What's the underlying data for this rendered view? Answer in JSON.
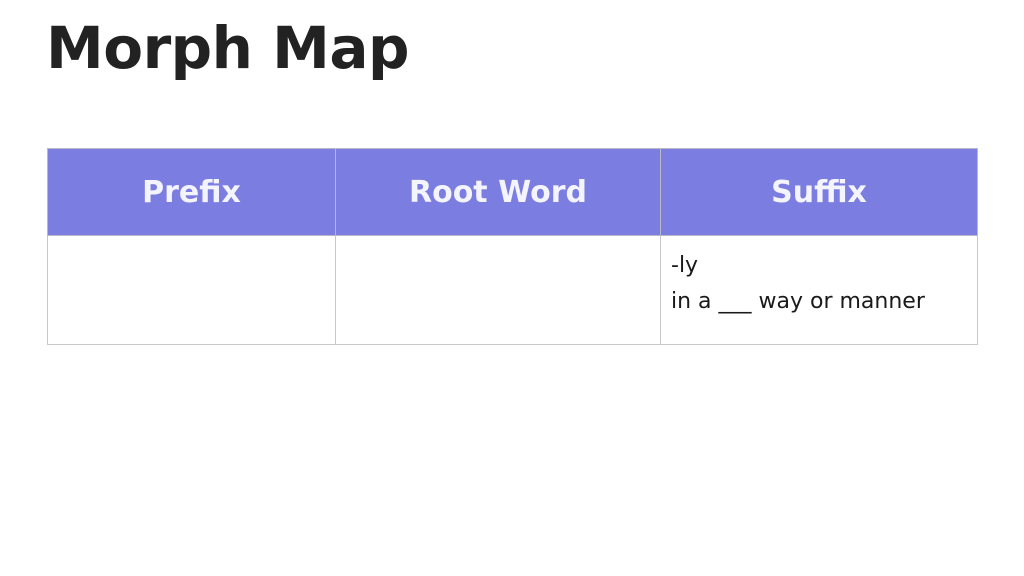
{
  "page": {
    "title": "Morph Map"
  },
  "table": {
    "headers": [
      "Prefix",
      "Root Word",
      "Suffix"
    ],
    "rows": [
      {
        "prefix": "",
        "root_word": "",
        "suffix_lines": [
          "-ly",
          "in a ___ way or manner"
        ]
      }
    ]
  },
  "colors": {
    "header_background": "#7b7ee0",
    "header_text": "#f4f4ff",
    "title_text": "#222222"
  }
}
